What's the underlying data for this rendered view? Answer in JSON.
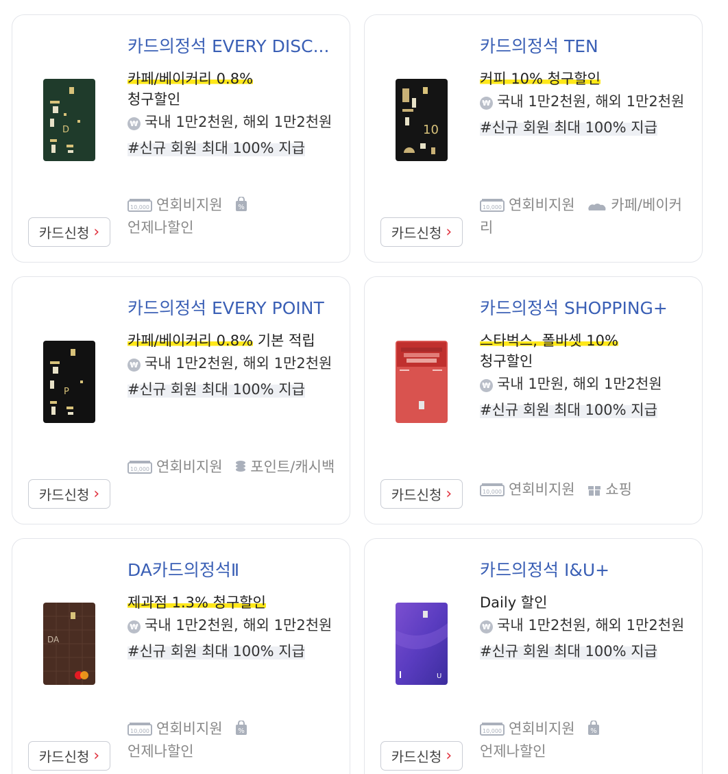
{
  "apply_label": "카드신청",
  "cards": [
    {
      "title": "카드의정석 EVERY DISC...",
      "benefit_hl": "카페/베이커리 0.8%",
      "benefit_rest": "청구할인",
      "fee": "국내 1만2천원, 해외 1만2천원",
      "tag": "#신규 회원 최대 100% 지급",
      "feature1": "연회비지원",
      "feature2": "언제나할인",
      "feature2_icon": "percent-bag-icon",
      "card_design": "green-every-discount"
    },
    {
      "title": "카드의정석 TEN",
      "benefit_hl": "커피 10% 청구할인",
      "benefit_rest": "",
      "fee": "국내 1만2천원, 해외 1만2천원",
      "tag": "#신규 회원 최대 100% 지급",
      "feature1": "연회비지원",
      "feature2": "카페/베이커리",
      "feature2_icon": "cafe-icon",
      "card_design": "black-ten"
    },
    {
      "title": "카드의정석 EVERY POINT",
      "benefit_hl": "카페/베이커리 0.8%",
      "benefit_rest": "기본 적립",
      "fee": "국내 1만2천원, 해외 1만2천원",
      "tag": "#신규 회원 최대 100% 지급",
      "feature1": "연회비지원",
      "feature2": "포인트/캐시백",
      "feature2_icon": "coins-icon",
      "card_design": "black-every-point"
    },
    {
      "title": "카드의정석 SHOPPING+",
      "benefit_hl": "스타벅스, 폴바셋 10%",
      "benefit_rest": "청구할인",
      "fee": "국내 1만원, 해외 1만2천원",
      "tag": "#신규 회원 최대 100% 지급",
      "feature1": "연회비지원",
      "feature2": "쇼핑",
      "feature2_icon": "gift-icon",
      "card_design": "red-shopping"
    },
    {
      "title": "DA카드의정석Ⅱ",
      "benefit_hl": "제과점 1.3% 청구할인",
      "benefit_rest": "",
      "fee": "국내 1만2천원, 해외 1만2천원",
      "tag": "#신규 회원 최대 100% 지급",
      "feature1": "연회비지원",
      "feature2": "언제나할인",
      "feature2_icon": "percent-bag-icon",
      "card_design": "brown-da"
    },
    {
      "title": "카드의정석 I&U+",
      "benefit_hl": "",
      "benefit_rest": "Daily 할인",
      "fee": "국내 1만2천원, 해외 1만2천원",
      "tag": "#신규 회원 최대 100% 지급",
      "feature1": "연회비지원",
      "feature2": "언제나할인",
      "feature2_icon": "percent-bag-icon",
      "card_design": "purple-iu"
    }
  ]
}
